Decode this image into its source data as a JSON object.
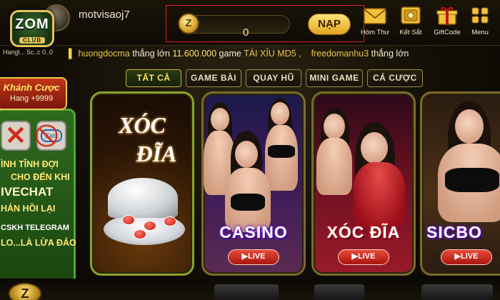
{
  "header": {
    "logo_main": "ZOM",
    "logo_sub": "CLUB",
    "username": "motvisaoj7",
    "uid_text": "Hangl... 5c..c 0..0"
  },
  "balance": {
    "coin_symbol": "Z",
    "value": "0",
    "deposit_label": "NẠP"
  },
  "menu": [
    {
      "label": "Hòm Thư",
      "icon": "mail-icon"
    },
    {
      "label": "Kết Sắt",
      "icon": "safe-icon"
    },
    {
      "label": "GiftCode",
      "icon": "gift-icon"
    },
    {
      "label": "Menu",
      "icon": "menu-icon"
    }
  ],
  "ticker": {
    "entries": [
      {
        "name": "huongdocma",
        "text": "thắng lớn",
        "amount": "11.600.000",
        "suffix": "game",
        "game": "TÀI XỈU MD5 ,"
      },
      {
        "name": "freedomanhu3",
        "text": "thắng lớn",
        "amount": "",
        "suffix": "",
        "game": ""
      }
    ]
  },
  "filters": [
    {
      "label": "TẤT CẢ",
      "active": true
    },
    {
      "label": "GAME BÀI",
      "active": false
    },
    {
      "label": "QUAY HŨ",
      "active": false
    },
    {
      "label": "MINI GAME",
      "active": false
    },
    {
      "label": "CÁ CƯỢC",
      "active": false
    }
  ],
  "promo": {
    "banner_l1": "Khánh Cược",
    "banner_l2": "Hang +9999",
    "lines": [
      "ÌNH TĨNH ĐỢI",
      "CHO ĐẾN KHI",
      "IVECHAT",
      "HẢN HỒI LẠI",
      "CSKH TELEGRAM",
      "LO...LÀ LỪA ĐẢO"
    ],
    "icon2_text": "Zalo"
  },
  "games": [
    {
      "title_top": "XÓC",
      "title_bottom": "ĐĨA",
      "label": "",
      "live": ""
    },
    {
      "title_top": "",
      "title_bottom": "",
      "label": "CASINO",
      "live": "▶LIVE"
    },
    {
      "title_top": "",
      "title_bottom": "",
      "label": "XÓC ĐĨA",
      "live": "▶LIVE"
    },
    {
      "title_top": "",
      "title_bottom": "",
      "label": "SICBO",
      "live": "▶LIVE"
    }
  ],
  "bottom": {
    "coin_symbol": "Z"
  },
  "colors": {
    "accent_gold": "#e5c45a",
    "live_red": "#d82a1c",
    "promo_green": "#2f6a1f",
    "highlight_box": "#d9221e"
  }
}
